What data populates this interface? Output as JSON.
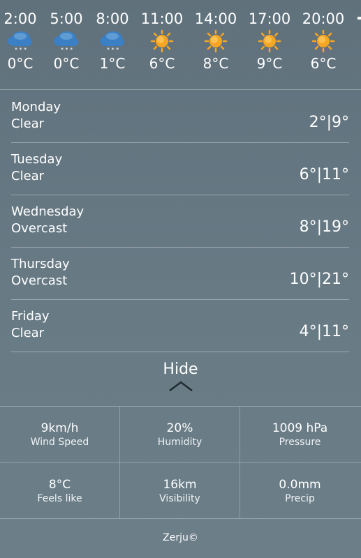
{
  "hourly": [
    {
      "time": "2:00",
      "icon": "snow-cloud-icon",
      "temp": "0°C"
    },
    {
      "time": "5:00",
      "icon": "snow-cloud-icon",
      "temp": "0°C"
    },
    {
      "time": "8:00",
      "icon": "snow-cloud-icon",
      "temp": "1°C"
    },
    {
      "time": "11:00",
      "icon": "sun-icon",
      "temp": "6°C"
    },
    {
      "time": "14:00",
      "icon": "sun-icon",
      "temp": "8°C"
    },
    {
      "time": "17:00",
      "icon": "sun-icon",
      "temp": "9°C"
    },
    {
      "time": "20:00",
      "icon": "sun-icon",
      "temp": "6°C"
    }
  ],
  "days": [
    {
      "name": "Monday",
      "condition": "Clear",
      "range": "2°|9°"
    },
    {
      "name": "Tuesday",
      "condition": "Clear",
      "range": "6°|11°"
    },
    {
      "name": "Wednesday",
      "condition": "Overcast",
      "range": "8°|19°"
    },
    {
      "name": "Thursday",
      "condition": "Overcast",
      "range": "10°|21°"
    },
    {
      "name": "Friday",
      "condition": "Clear",
      "range": "4°|11°"
    }
  ],
  "hide_label": "Hide",
  "stats": [
    {
      "value": "9km/h",
      "label": "Wind Speed"
    },
    {
      "value": "20%",
      "label": "Humidity"
    },
    {
      "value": "1009 hPa",
      "label": "Pressure"
    },
    {
      "value": "8°C",
      "label": "Feels like"
    },
    {
      "value": "16km",
      "label": "Visibility"
    },
    {
      "value": "0.0mm",
      "label": "Precip"
    }
  ],
  "footer": "Zerju©",
  "colors": {
    "sun": "#f5a623",
    "cloud": "#3b7fc4",
    "background": "#667882"
  }
}
